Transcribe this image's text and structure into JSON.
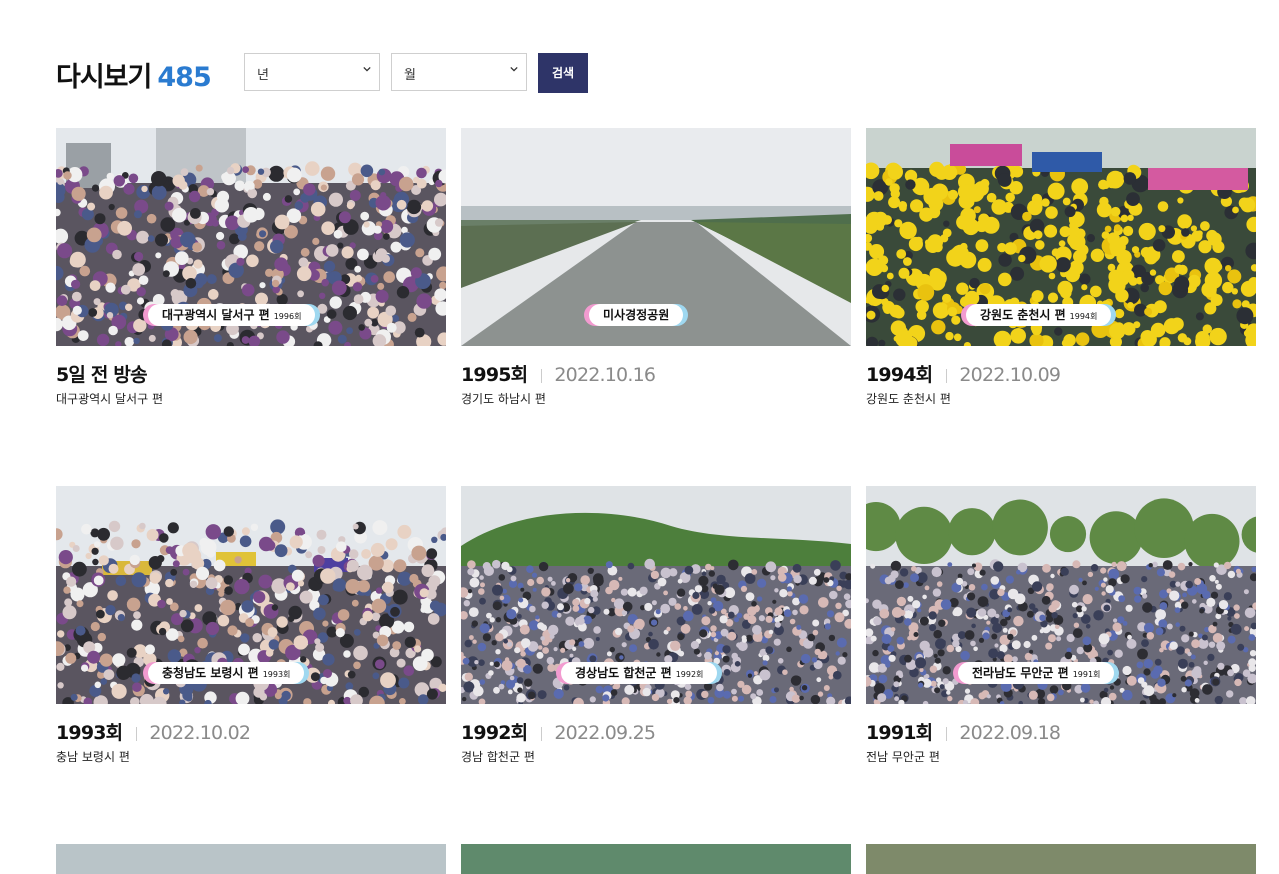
{
  "header": {
    "title": "다시보기",
    "count": "485",
    "year_select": "년",
    "month_select": "월",
    "search_label": "검색",
    "chevron_icon": "chevron-down-icon"
  },
  "episodes": [
    {
      "episode": "5일 전 방송",
      "date": "",
      "subtitle": "대구광역시 달서구 편",
      "caption": "대구광역시 달서구 편",
      "caption_ep": "1996회",
      "scene": "crowd"
    },
    {
      "episode": "1995회",
      "date": "2022.10.16",
      "subtitle": "경기도 하남시 편",
      "caption": "미사경정공원",
      "caption_ep": "",
      "scene": "river"
    },
    {
      "episode": "1994회",
      "date": "2022.10.09",
      "subtitle": "강원도 춘천시 편",
      "caption": "강원도 춘천시 편",
      "caption_ep": "1994회",
      "scene": "yellow"
    },
    {
      "episode": "1993회",
      "date": "2022.10.02",
      "subtitle": "충남 보령시 편",
      "caption": "충청남도 보령시 편",
      "caption_ep": "1993회",
      "scene": "crowd2"
    },
    {
      "episode": "1992회",
      "date": "2022.09.25",
      "subtitle": "경남 합천군 편",
      "caption": "경상남도 합천군 편",
      "caption_ep": "1992회",
      "scene": "field"
    },
    {
      "episode": "1991회",
      "date": "2022.09.18",
      "subtitle": "전남 무안군 편",
      "caption": "전라남도 무안군 편",
      "caption_ep": "1991회",
      "scene": "trees"
    }
  ],
  "colors": {
    "accent": "#2a7bd0",
    "button": "#2e3468"
  }
}
